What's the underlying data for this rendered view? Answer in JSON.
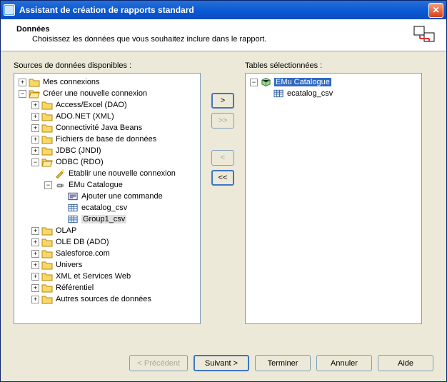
{
  "window": {
    "title": "Assistant de création de rapports standard"
  },
  "header": {
    "title": "Données",
    "subtitle": "Choisissez les données que vous souhaitez inclure dans le rapport."
  },
  "panels": {
    "left_label": "Sources de données disponibles :",
    "right_label": "Tables sélectionnées :"
  },
  "tree": {
    "mes_connexions": "Mes connexions",
    "creer": "Créer une nouvelle connexion",
    "access": "Access/Excel (DAO)",
    "adonet": "ADO.NET (XML)",
    "java": "Connectivité Java Beans",
    "fichiers": "Fichiers de base de données",
    "jdbc": "JDBC (JNDI)",
    "odbc": "ODBC (RDO)",
    "etablir": "Etablir une nouvelle connexion",
    "emu": "EMu Catalogue",
    "ajouter": "Ajouter une commande",
    "ecatalog": "ecatalog_csv",
    "group1": "Group1_csv",
    "olap": "OLAP",
    "oledb": "OLE DB (ADO)",
    "salesforce": "Salesforce.com",
    "univers": "Univers",
    "xml": "XML et Services Web",
    "ref": "Référentiel",
    "autres": "Autres sources de données"
  },
  "selected_tree": {
    "emu": "EMu Catalogue",
    "ecatalog": "ecatalog_csv"
  },
  "arrows": {
    "add": ">",
    "add_all": ">>",
    "remove": "<",
    "remove_all": "<<"
  },
  "footer": {
    "back": "< Précédent",
    "next": "Suivant >",
    "finish": "Terminer",
    "cancel": "Annuler",
    "help": "Aide"
  }
}
